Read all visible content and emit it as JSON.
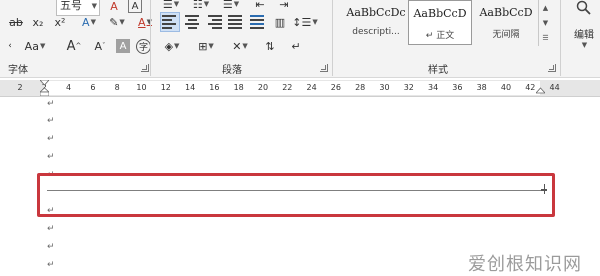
{
  "ribbon": {
    "font_group": {
      "font_size": "五号",
      "label": "字体",
      "subscript_label": "x₂",
      "superscript_label": "x²",
      "change_case_label": "Aa",
      "grow_font_label": "A",
      "shrink_font_label": "A",
      "char_shading_label": "A",
      "phonetic_label": "字"
    },
    "paragraph_group": {
      "label": "段落"
    },
    "styles_group": {
      "label": "样式",
      "items": [
        {
          "sample": "AaBbCcDc",
          "name": "descripti..."
        },
        {
          "sample": "AaBbCcD",
          "name": "↵ 正文"
        },
        {
          "sample": "AaBbCcD",
          "name": "无间隔"
        }
      ]
    },
    "editing_group": {
      "label": "编辑"
    }
  },
  "ruler": {
    "ticks": [
      "2",
      "2",
      "4",
      "6",
      "8",
      "10",
      "12",
      "14",
      "16",
      "18",
      "20",
      "22",
      "24",
      "26",
      "28",
      "30",
      "32",
      "34",
      "36",
      "38",
      "40",
      "42",
      "44"
    ]
  },
  "document": {
    "paragraph_mark": "↵"
  },
  "watermark": "爱创根知识网"
}
